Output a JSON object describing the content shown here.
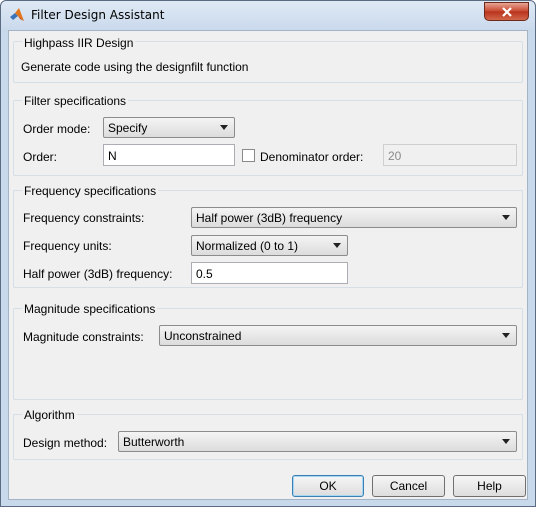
{
  "window": {
    "title": "Filter Design Assistant"
  },
  "design_panel": {
    "title": "Highpass IIR Design",
    "description": "Generate code using the designfilt function"
  },
  "filter_specs": {
    "title": "Filter specifications",
    "order_mode_label": "Order mode:",
    "order_mode_value": "Specify",
    "order_label": "Order:",
    "order_value": "N",
    "denominator_checked": false,
    "denominator_label": "Denominator order:",
    "denominator_value": "20"
  },
  "frequency_specs": {
    "title": "Frequency specifications",
    "constraints_label": "Frequency constraints:",
    "constraints_value": "Half power (3dB) frequency",
    "units_label": "Frequency units:",
    "units_value": "Normalized (0 to 1)",
    "half_power_label": "Half power (3dB) frequency:",
    "half_power_value": "0.5"
  },
  "magnitude_specs": {
    "title": "Magnitude specifications",
    "constraints_label": "Magnitude constraints:",
    "constraints_value": "Unconstrained"
  },
  "algorithm": {
    "title": "Algorithm",
    "design_method_label": "Design method:",
    "design_method_value": "Butterworth"
  },
  "buttons": {
    "ok": "OK",
    "cancel": "Cancel",
    "help": "Help"
  },
  "colors": {
    "title_bar": "#c9d9ec",
    "close_button": "#c7452c",
    "dialog_bg": "#f0f0f0"
  }
}
